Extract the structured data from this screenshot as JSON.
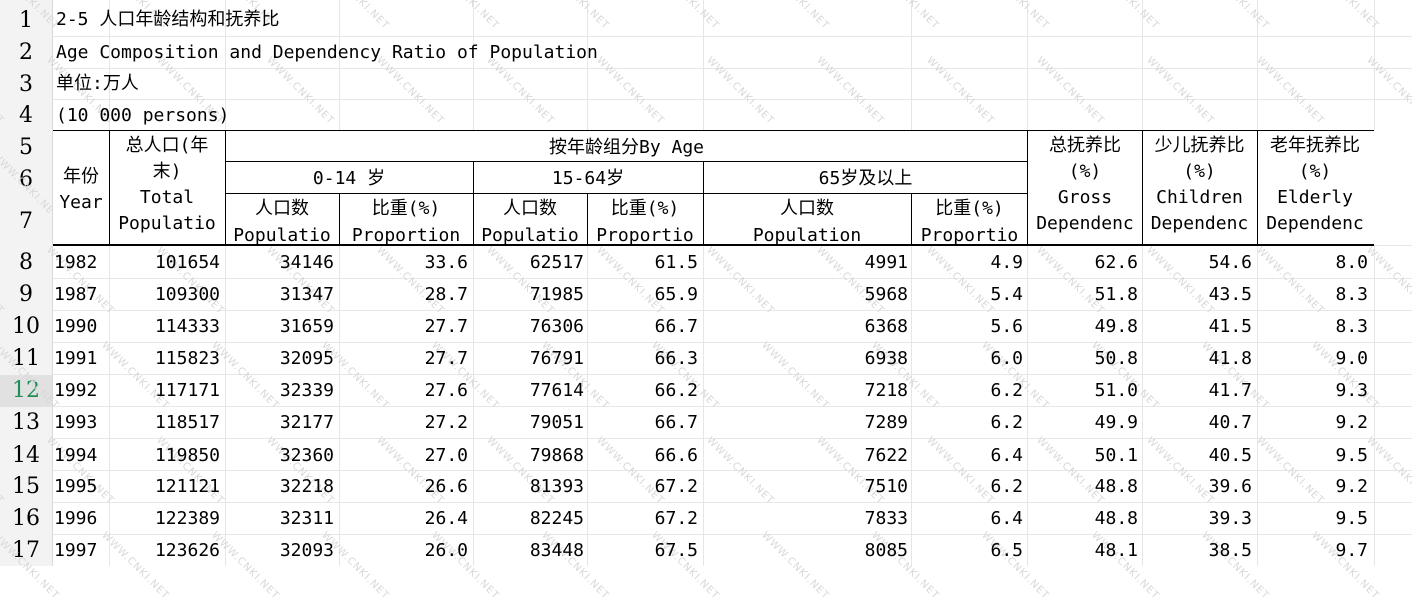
{
  "title_lines": [
    "2-5 人口年龄结构和抚养比",
    "Age Composition and Dependency Ratio of Population",
    "单位:万人",
    "(10 000 persons)"
  ],
  "row_numbers": [
    "1",
    "2",
    "3",
    "4",
    "5",
    "6",
    "7",
    "8",
    "9",
    "10",
    "11",
    "12",
    "13",
    "14",
    "15",
    "16",
    "17"
  ],
  "selected_row": "12",
  "headers": {
    "year_cn": "年份",
    "year_en": "Year",
    "total_cn1": "总人口(年",
    "total_cn2": "末)",
    "total_en1": "Total",
    "total_en2": "Populatio",
    "by_age": "按年龄组分By Age",
    "age_0_14": "0-14 岁",
    "age_15_64": "15-64岁",
    "age_65": "65岁及以上",
    "pop_cn": "人口数",
    "pop_en": "Populatio",
    "prop_cn": "比重(%)",
    "prop_en_full": "Proportion",
    "prop_en": "Proportio",
    "pop_en_full": "Population",
    "gross_cn": "总抚养比",
    "gross_pct": "(%)",
    "gross_en1": "Gross",
    "gross_en2": "Dependenc",
    "child_cn": "少儿抚养比",
    "child_pct": "(%)",
    "child_en1": "Children",
    "child_en2": "Dependenc",
    "elder_cn": "老年抚养比",
    "elder_pct": "(%)",
    "elder_en1": "Elderly",
    "elder_en2": "Dependenc"
  },
  "rows": [
    [
      "1982",
      "101654",
      "34146",
      "33.6",
      "62517",
      "61.5",
      "4991",
      "4.9",
      "62.6",
      "54.6",
      "8.0"
    ],
    [
      "1987",
      "109300",
      "31347",
      "28.7",
      "71985",
      "65.9",
      "5968",
      "5.4",
      "51.8",
      "43.5",
      "8.3"
    ],
    [
      "1990",
      "114333",
      "31659",
      "27.7",
      "76306",
      "66.7",
      "6368",
      "5.6",
      "49.8",
      "41.5",
      "8.3"
    ],
    [
      "1991",
      "115823",
      "32095",
      "27.7",
      "76791",
      "66.3",
      "6938",
      "6.0",
      "50.8",
      "41.8",
      "9.0"
    ],
    [
      "1992",
      "117171",
      "32339",
      "27.6",
      "77614",
      "66.2",
      "7218",
      "6.2",
      "51.0",
      "41.7",
      "9.3"
    ],
    [
      "1993",
      "118517",
      "32177",
      "27.2",
      "79051",
      "66.7",
      "7289",
      "6.2",
      "49.9",
      "40.7",
      "9.2"
    ],
    [
      "1994",
      "119850",
      "32360",
      "27.0",
      "79868",
      "66.6",
      "7622",
      "6.4",
      "50.1",
      "40.5",
      "9.5"
    ],
    [
      "1995",
      "121121",
      "32218",
      "26.6",
      "81393",
      "67.2",
      "7510",
      "6.2",
      "48.8",
      "39.6",
      "9.2"
    ],
    [
      "1996",
      "122389",
      "32311",
      "26.4",
      "82245",
      "67.2",
      "7833",
      "6.4",
      "48.8",
      "39.3",
      "9.5"
    ],
    [
      "1997",
      "123626",
      "32093",
      "26.0",
      "83448",
      "67.5",
      "8085",
      "6.5",
      "48.1",
      "38.5",
      "9.7"
    ]
  ],
  "watermark": "WWW.CNKI.NET"
}
